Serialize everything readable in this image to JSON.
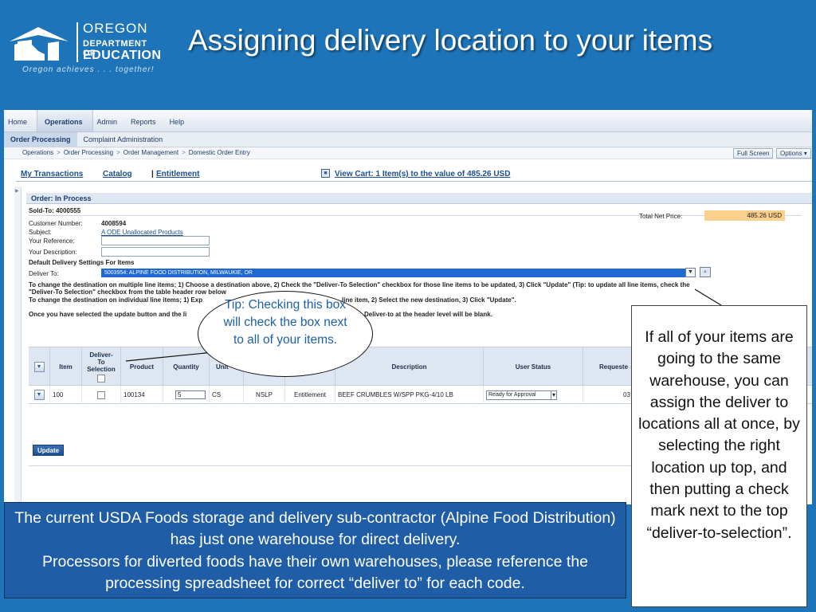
{
  "slide": {
    "title": "Assigning delivery location to your items",
    "logo": {
      "line1": "OREGON",
      "line2": "DEPARTMENT OF",
      "line3": "EDUCATION",
      "tagline": "Oregon achieves . . . together!"
    }
  },
  "app": {
    "top_nav": [
      "Home",
      "Operations",
      "Admin",
      "Reports",
      "Help"
    ],
    "sub_nav": [
      "Order Processing",
      "Complaint Administration"
    ],
    "breadcrumbs": [
      "Operations",
      "Order Processing",
      "Order Management",
      "Domestic Order Entry"
    ],
    "buttons": {
      "full_screen": "Full Screen",
      "options": "Options ▾"
    },
    "links": {
      "my_transactions": "My Transactions",
      "catalog": "Catalog",
      "entitlement_sep": "|",
      "entitlement": "Entitlement",
      "view_cart": "View Cart: 1 Item(s) to the value of 485.26 USD"
    },
    "panel_title": "Order: In Process",
    "sold_to": "Sold-To: 4000555",
    "fields": {
      "customer_number_label": "Customer Number:",
      "customer_number": "4008594",
      "subject_label": "Subject:",
      "subject": "A ODE Unallocated Products",
      "your_reference_label": "Your Reference:",
      "your_description_label": "Your Description:",
      "total_net_price_label": "Total Net Price:",
      "total_net_price": "485.26 USD"
    },
    "default_delivery": {
      "heading": "Default Delivery Settings For Items",
      "deliver_to_label": "Deliver To:",
      "deliver_to_value": "5003954: ALPINE FOOD DISTRIBUTION, MILWAUKIE, OR"
    },
    "instructions": {
      "line1": "To change the destination on multiple line items; 1) Choose a destination above, 2) Check the \"Deliver-To Selection\" checkbox for those line items to be updated, 3) Click \"Update\" (Tip: to update all line items, check the",
      "line2": "\"Deliver-To Selection\" checkbox from the table header row below",
      "line3": "To change the destination on individual line items; 1) Exp",
      "line3b": "line item, 2) Select the new destination, 3) Click \"Update\".",
      "line4": "Once you have selected the update button and the li",
      "line4b": "Deliver-to at the header level will be blank."
    },
    "table": {
      "headers": {
        "deliver_to_selection": "Deliver-\nTo\nSelection",
        "item": "Item",
        "product": "Product",
        "quantity": "Quantity",
        "unit": "Unit",
        "description": "Description",
        "user_status": "User Status",
        "requested": "Requeste"
      },
      "row": {
        "item": "100",
        "product": "100134",
        "quantity": "5",
        "unit": "CS",
        "program": "NSLP",
        "type": "Entitlement",
        "description": "BEEF CRUMBLES W/SPP PKG-4/10 LB",
        "user_status": "Ready for Approval",
        "requested": "03"
      }
    },
    "update_button": "Update"
  },
  "callouts": {
    "tip": "Tip: Checking this box will check the box next to all of your items.",
    "right": "If all of your items are going to the same warehouse, you can assign the deliver to locations all at once, by selecting the right location up top, and then putting a check mark next to the top “deliver-to-selection”.",
    "bottom_line1": "The current USDA Foods storage and delivery sub-contractor  (Alpine Food Distribution) has just one warehouse for direct delivery.",
    "bottom_line2": "Processors for diverted foods have their own warehouses, please reference the processing spreadsheet for correct “deliver to” for each code."
  },
  "colors": {
    "background": "#1e74b8",
    "note_box": "#1f5ea6",
    "total_highlight": "#fbcf8c",
    "selection_blue": "#1f6ad1"
  }
}
